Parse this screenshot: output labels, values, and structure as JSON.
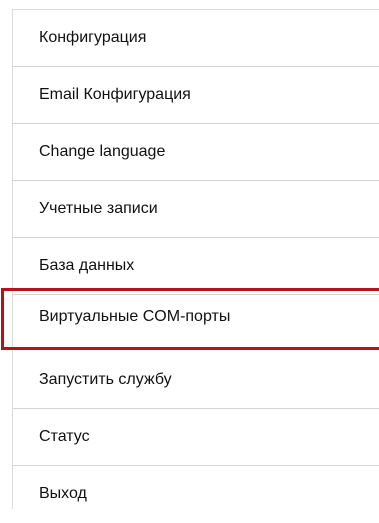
{
  "menu": {
    "highlight_color": "#b5121b",
    "items": [
      {
        "label": "Конфигурация"
      },
      {
        "label": "Email Конфигурация"
      },
      {
        "label": "Change language"
      },
      {
        "label": "Учетные записи"
      },
      {
        "label": "База данных"
      },
      {
        "label": "Виртуальные COM-порты",
        "highlighted": true
      },
      {
        "label": "Запустить службу"
      },
      {
        "label": "Статус"
      },
      {
        "label": "Выход"
      }
    ]
  }
}
